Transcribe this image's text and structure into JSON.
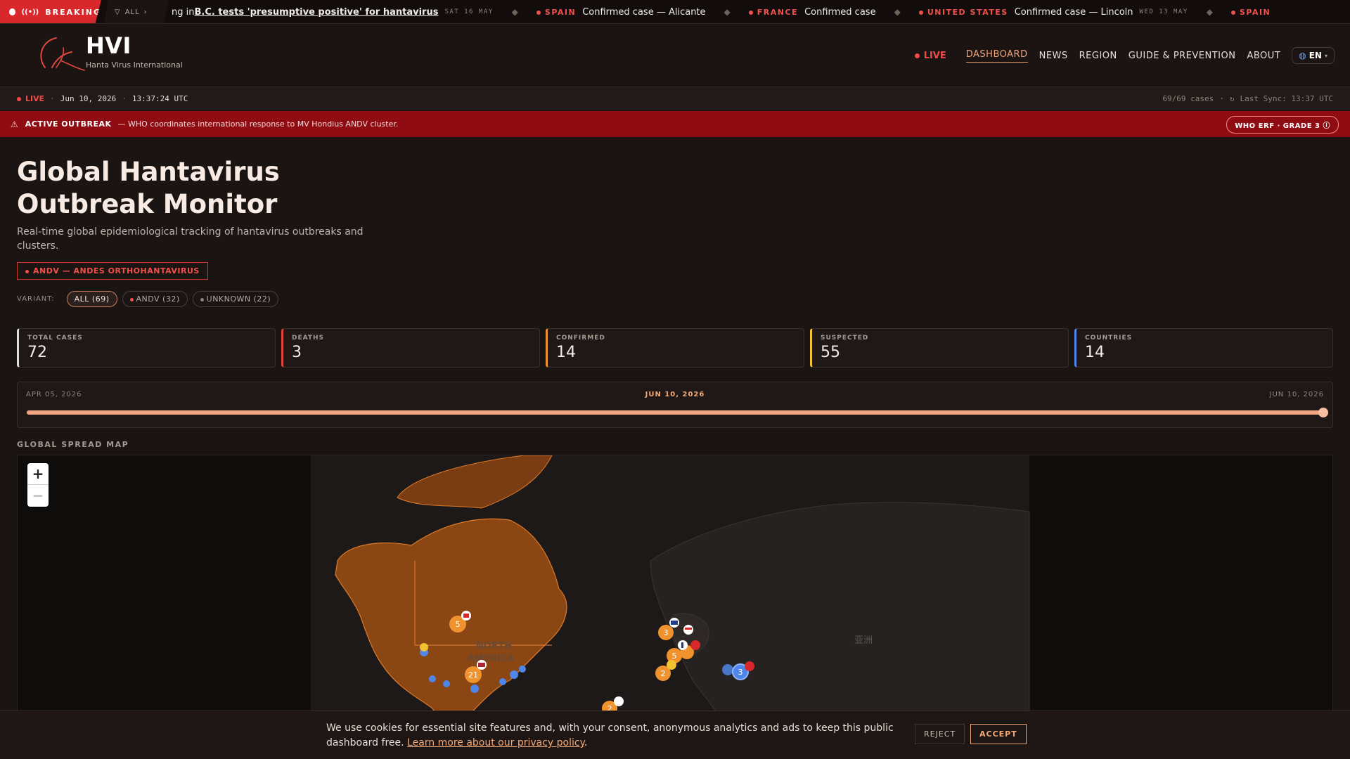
{
  "ticker": {
    "breaking_label": "BREAKING",
    "filter_label": "ALL",
    "items": [
      {
        "country": "",
        "text_prefix": "ng in ",
        "text": "B.C. tests 'presumptive positive' for hantavirus",
        "date": "SAT 16 MAY"
      },
      {
        "country": "SPAIN",
        "text": "Confirmed case — Alicante",
        "date": ""
      },
      {
        "country": "FRANCE",
        "text": "Confirmed case",
        "date": ""
      },
      {
        "country": "UNITED STATES",
        "text": "Confirmed case — Lincoln",
        "date": "WED 13 MAY"
      },
      {
        "country": "SPAIN",
        "text": "",
        "date": ""
      }
    ]
  },
  "header": {
    "brand_name": "HVI",
    "brand_sub": "Hanta Virus International",
    "live_label": "LIVE",
    "nav": [
      "DASHBOARD",
      "NEWS",
      "REGION",
      "GUIDE & PREVENTION",
      "ABOUT"
    ],
    "lang": "EN"
  },
  "status": {
    "live": "LIVE",
    "date": "Jun 10, 2026",
    "time": "13:37:24 UTC",
    "cases": "69/69 cases",
    "sync": "Last Sync: 13:37 UTC"
  },
  "alert": {
    "title": "ACTIVE OUTBREAK",
    "text": "— WHO coordinates international response to MV Hondius ANDV cluster.",
    "badge": "WHO ERF · GRADE 3"
  },
  "hero": {
    "title": "Global Hantavirus Outbreak Monitor",
    "subtitle": "Real-time global epidemiological tracking of hantavirus outbreaks and clusters.",
    "variant_tag": "ANDV — ANDES ORTHOHANTAVIRUS",
    "variant_label": "VARIANT:",
    "chips": [
      {
        "label": "ALL (69)",
        "dot": ""
      },
      {
        "label": "ANDV (32)",
        "dot": "#f0514a"
      },
      {
        "label": "UNKNOWN (22)",
        "dot": "#8a817c"
      }
    ]
  },
  "stats": [
    {
      "label": "TOTAL CASES",
      "value": "72",
      "color": "#e0e0e0"
    },
    {
      "label": "DEATHS",
      "value": "3",
      "color": "#e0413b"
    },
    {
      "label": "CONFIRMED",
      "value": "14",
      "color": "#f0932f"
    },
    {
      "label": "SUSPECTED",
      "value": "55",
      "color": "#f0c232"
    },
    {
      "label": "COUNTRIES",
      "value": "14",
      "color": "#4f86e8"
    }
  ],
  "timeline": {
    "start": "APR 05, 2026",
    "current": "JUN 10, 2026",
    "end": "JUN 10, 2026",
    "progress": 1.0
  },
  "map": {
    "title": "GLOBAL SPREAD MAP",
    "labels": [
      "NORTH",
      "AMERICA",
      "亚洲"
    ],
    "clusters": [
      "5",
      "21",
      "3",
      "5",
      "2",
      "3",
      "2"
    ],
    "zoom_in": "+",
    "zoom_out": "−"
  },
  "cookie": {
    "text": "We use cookies for essential site features and, with your consent, anonymous analytics and ads to keep this public dashboard free.",
    "link": "Learn more about our privacy policy",
    "reject": "REJECT",
    "accept": "ACCEPT"
  }
}
